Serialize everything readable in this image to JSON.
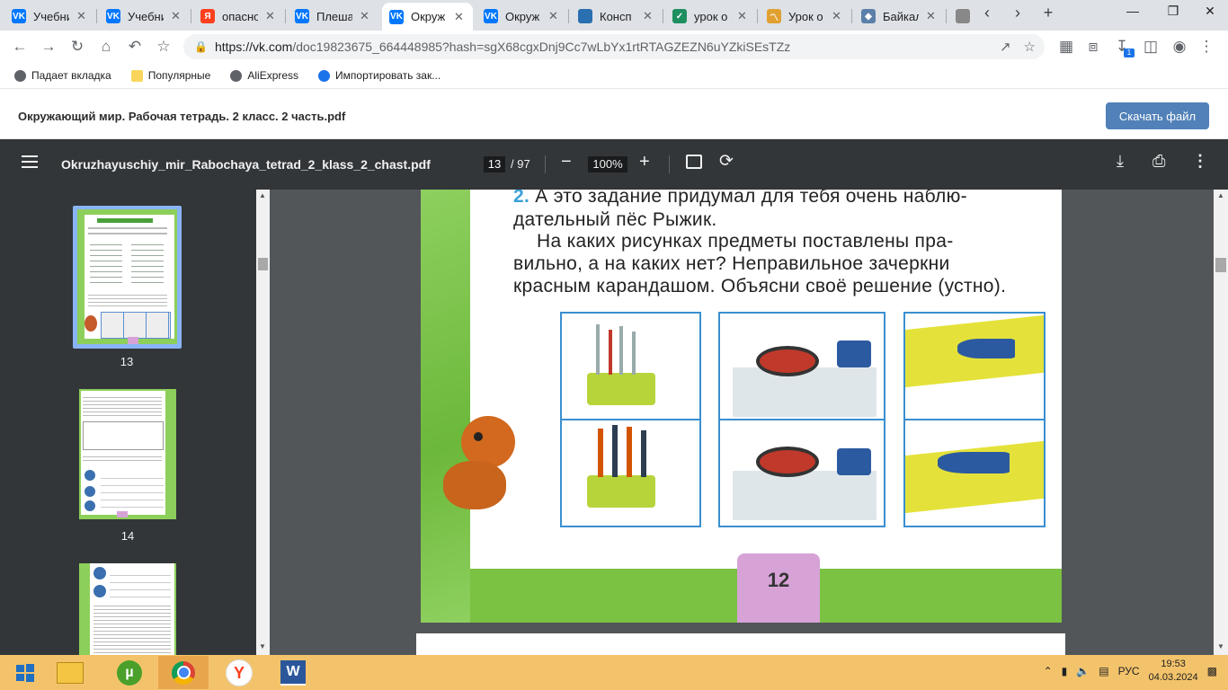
{
  "browser": {
    "tabs": [
      {
        "title": "Учебни",
        "icon": "vk-icon",
        "color": "#0077ff",
        "glyph": "VK"
      },
      {
        "title": "Учебни",
        "icon": "vk-icon",
        "color": "#0077ff",
        "glyph": "VK"
      },
      {
        "title": "опасно",
        "icon": "yandex-icon",
        "color": "#fc3f1d",
        "glyph": "Я"
      },
      {
        "title": "Плеша",
        "icon": "vk-icon",
        "color": "#0077ff",
        "glyph": "VK"
      },
      {
        "title": "Окруж",
        "icon": "vk-icon",
        "color": "#0077ff",
        "glyph": "VK",
        "active": true
      },
      {
        "title": "Окруж",
        "icon": "vk-icon",
        "color": "#0077ff",
        "glyph": "VK"
      },
      {
        "title": "Консп",
        "icon": "book-icon",
        "color": "#2a6fb0",
        "glyph": ""
      },
      {
        "title": "урок о",
        "icon": "check-icon",
        "color": "#1f8f5f",
        "glyph": "✓"
      },
      {
        "title": "Урок о",
        "icon": "chart-icon",
        "color": "#e0a030",
        "glyph": "〽"
      },
      {
        "title": "Байкал",
        "icon": "globe-icon",
        "color": "#5b7fa8",
        "glyph": "◆"
      },
      {
        "title": "",
        "icon": "doc-icon",
        "color": "#888888",
        "glyph": ""
      }
    ],
    "url_host": "https://vk.com",
    "url_path": "/doc19823675_664448985?hash=sgX68cgxDnj9Cc7wLbYx1rtRTAGZEZN6uYZkiSEsTZz",
    "download_badge": "1",
    "bookmarks": [
      {
        "label": "Падает вкладка",
        "icon": "globe-icon",
        "color": "#5f6368"
      },
      {
        "label": "Популярные",
        "icon": "folder-icon",
        "color": "#f9d65b"
      },
      {
        "label": "AliExpress",
        "icon": "globe-icon",
        "color": "#5f6368"
      },
      {
        "label": "Импортировать зак...",
        "icon": "gear-icon",
        "color": "#1a73e8"
      }
    ]
  },
  "vkdoc": {
    "title": "Окружающий мир. Рабочая тетрадь. 2 класс. 2 часть.pdf",
    "download_label": "Скачать файл"
  },
  "pdf": {
    "filename": "Okruzhayuschiy_mir_Rabochaya_tetrad_2_klass_2_chast.pdf",
    "page_current": "13",
    "page_total": "/ 97",
    "zoom": "100%",
    "thumbnails": [
      "13",
      "14"
    ]
  },
  "page": {
    "task_number": "2.",
    "line1": "А это задание придумал для тебя очень наблю-",
    "line2": "дательный пёс Рыжик.",
    "line3": "На каких рисунках предметы поставлены пра-",
    "line4": "вильно, а на каких нет? Неправильное зачеркни",
    "line5": "красным карандашом. Объясни своё решение (устно).",
    "page_number": "12"
  },
  "taskbar": {
    "lang": "РУС",
    "time": "19:53",
    "date": "04.03.2024"
  }
}
